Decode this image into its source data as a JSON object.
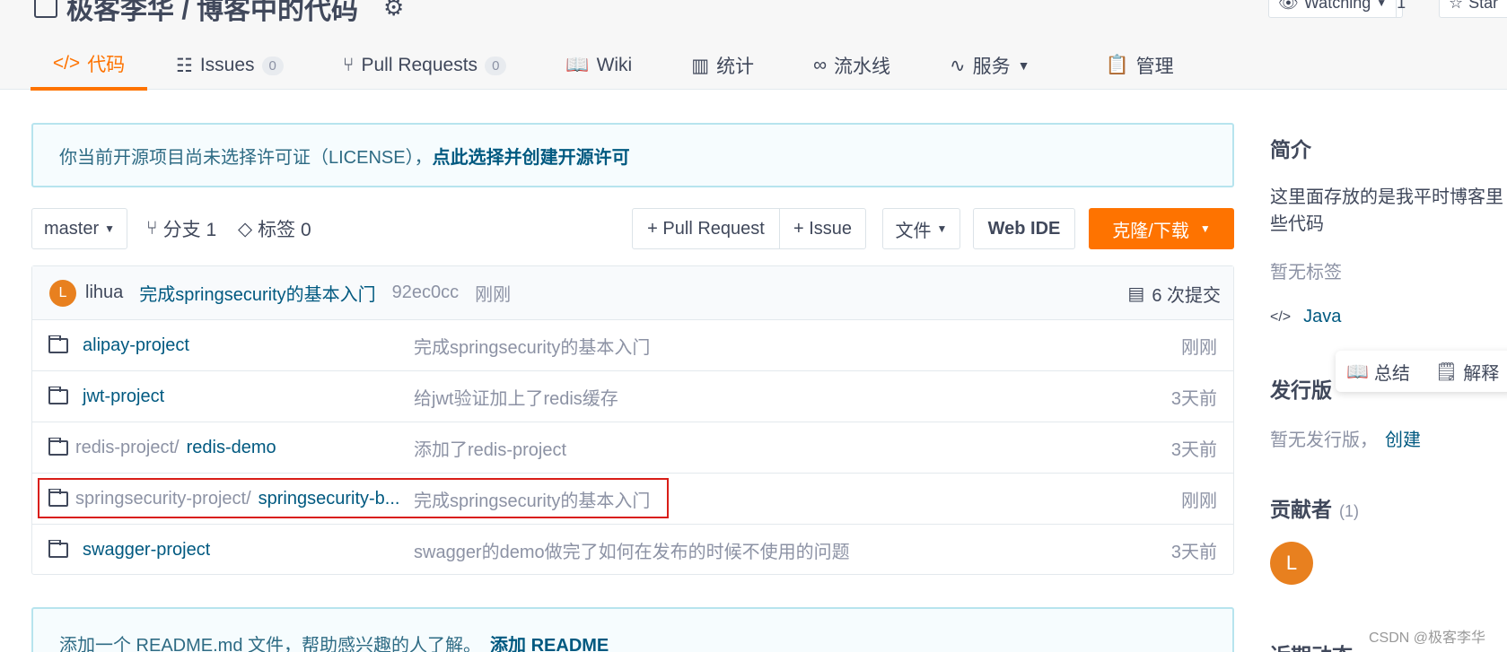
{
  "header": {
    "repo_title": "极客李华 / 博客中的代码",
    "watch_label": "Watching",
    "watch_count": "1",
    "star_label": "Star"
  },
  "tabs": [
    {
      "label": "代码",
      "icon": "code-icon"
    },
    {
      "label": "Issues",
      "badge": "0",
      "icon": "issues-icon"
    },
    {
      "label": "Pull Requests",
      "badge": "0",
      "icon": "pull-request-icon"
    },
    {
      "label": "Wiki",
      "icon": "book-icon"
    },
    {
      "label": "统计",
      "icon": "bar-chart-icon"
    },
    {
      "label": "流水线",
      "icon": "pipeline-icon"
    },
    {
      "label": "服务",
      "icon": "pulse-icon"
    },
    {
      "label": "管理",
      "icon": "manage-icon"
    }
  ],
  "notice": {
    "text": "你当前开源项目尚未选择许可证（LICENSE），",
    "link": "点此选择并创建开源许可"
  },
  "toolbar": {
    "branch": "master",
    "branches": "分支 1",
    "tags": "标签 0",
    "pull_request": "+ Pull Request",
    "issue": "+ Issue",
    "files": "文件",
    "web_ide": "Web IDE",
    "clone": "克隆/下载"
  },
  "commit": {
    "avatar_letter": "L",
    "author": "lihua",
    "message": "完成springsecurity的基本入门",
    "sha": "92ec0cc",
    "time": "刚刚",
    "count": "6 次提交"
  },
  "files": [
    {
      "dir": "",
      "name": "alipay-project",
      "message": "完成springsecurity的基本入门",
      "time": "刚刚"
    },
    {
      "dir": "",
      "name": "jwt-project",
      "message": "给jwt验证加上了redis缓存",
      "time": "3天前"
    },
    {
      "dir": "redis-project/",
      "name": "redis-demo",
      "message": "添加了redis-project",
      "time": "3天前"
    },
    {
      "dir": "springsecurity-project/",
      "name": "springsecurity-b...",
      "message": "完成springsecurity的基本入门",
      "time": "刚刚"
    },
    {
      "dir": "",
      "name": "swagger-project",
      "message": "swagger的demo做完了如何在发布的时候不使用的问题",
      "time": "3天前"
    }
  ],
  "readme": {
    "text": "添加一个 README.md 文件，帮助感兴趣的人了解。",
    "link": "添加 README"
  },
  "sidebar": {
    "intro_title": "简介",
    "intro_text_1": "这里面存放的是我平时博客里",
    "intro_text_2": "些代码",
    "no_tags": "暂无标签",
    "language": "Java",
    "release_title": "发行版",
    "no_release": "暂无发行版，",
    "create": "创建",
    "contributors_title": "贡献者",
    "contributors_count": "(1)",
    "contributor_letter": "L",
    "activity_title": "近期动态"
  },
  "popup": {
    "summary": "总结",
    "explain": "解释"
  },
  "watermark": "CSDN @极客李华",
  "colors": {
    "accent": "#fe7300",
    "link": "#005980",
    "highlight": "#d91e18"
  }
}
